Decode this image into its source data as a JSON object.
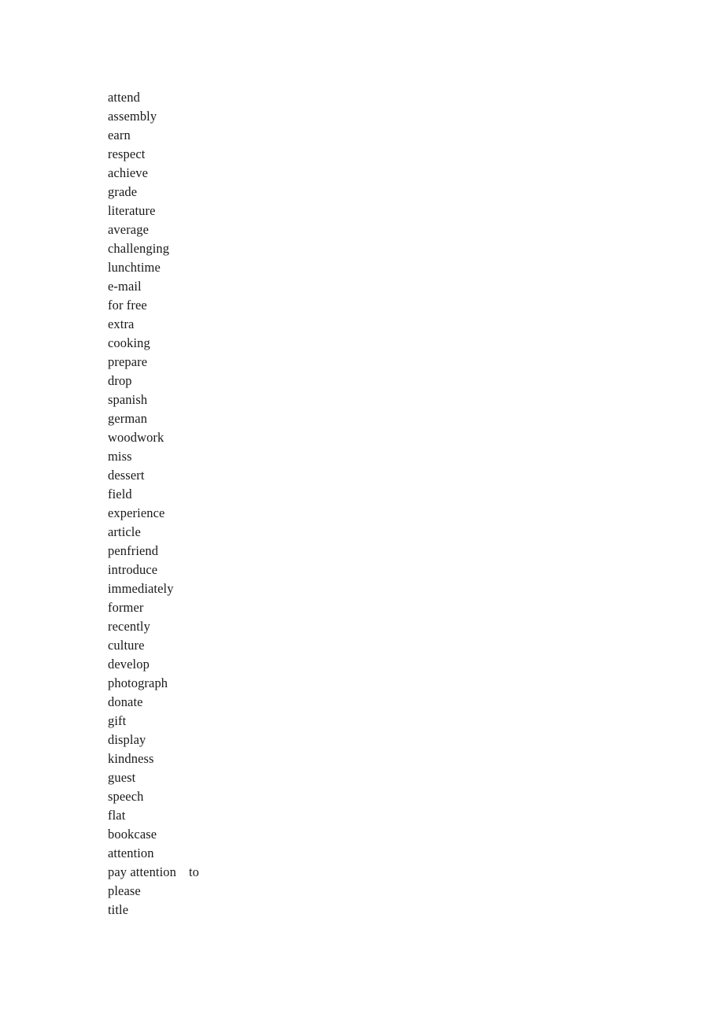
{
  "document": {
    "type": "vocabulary-word-list",
    "background_color": "#ffffff",
    "text_color": "#1a1a1a",
    "lines": [
      {
        "term": "attend"
      },
      {
        "term": "assembly"
      },
      {
        "term": "earn"
      },
      {
        "term": "respect"
      },
      {
        "term": "achieve"
      },
      {
        "term": "grade"
      },
      {
        "term": "literature"
      },
      {
        "term": "average"
      },
      {
        "term": "challenging"
      },
      {
        "term": "lunchtime"
      },
      {
        "term": "e-mail"
      },
      {
        "term": "for free"
      },
      {
        "term": "extra"
      },
      {
        "term": "cooking"
      },
      {
        "term": "prepare"
      },
      {
        "term": "drop"
      },
      {
        "term": "spanish"
      },
      {
        "term": "german"
      },
      {
        "term": "woodwork"
      },
      {
        "term": "miss"
      },
      {
        "term": "dessert"
      },
      {
        "term": "field"
      },
      {
        "term": "experience"
      },
      {
        "term": "article"
      },
      {
        "term": "penfriend"
      },
      {
        "term": "introduce"
      },
      {
        "term": "immediately"
      },
      {
        "term": "former"
      },
      {
        "term": "recently"
      },
      {
        "term": "culture"
      },
      {
        "term": "develop"
      },
      {
        "term": "photograph"
      },
      {
        "term": "donate"
      },
      {
        "term": "gift"
      },
      {
        "term": "display"
      },
      {
        "term": "kindness"
      },
      {
        "term": "guest"
      },
      {
        "term": "speech"
      },
      {
        "term": "flat"
      },
      {
        "term": "bookcase"
      },
      {
        "term": "attention"
      },
      {
        "term": "pay attention",
        "particle": "to"
      },
      {
        "term": "please"
      },
      {
        "term": "title"
      }
    ]
  }
}
